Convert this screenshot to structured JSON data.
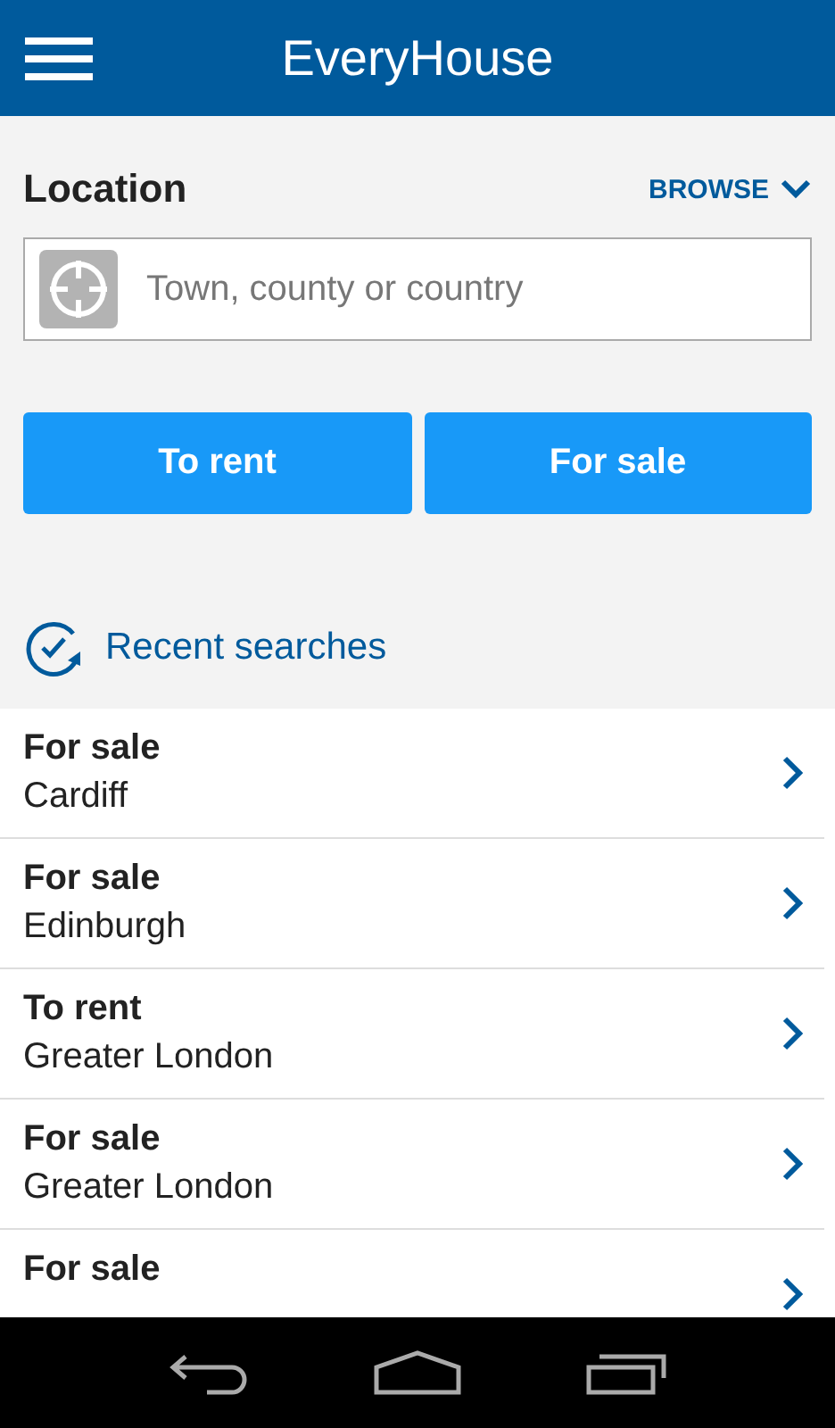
{
  "app_bar": {
    "title": "EveryHouse"
  },
  "location": {
    "label": "Location",
    "browse": "BROWSE",
    "placeholder": "Town, county or country"
  },
  "buttons": [
    "To rent",
    "For sale"
  ],
  "recent": {
    "heading": "Recent searches",
    "items": [
      {
        "type": "For sale",
        "place": "Cardiff"
      },
      {
        "type": "For sale",
        "place": "Edinburgh"
      },
      {
        "type": "To rent",
        "place": "Greater London"
      },
      {
        "type": "For sale",
        "place": "Greater London"
      },
      {
        "type": "For sale"
      }
    ]
  }
}
